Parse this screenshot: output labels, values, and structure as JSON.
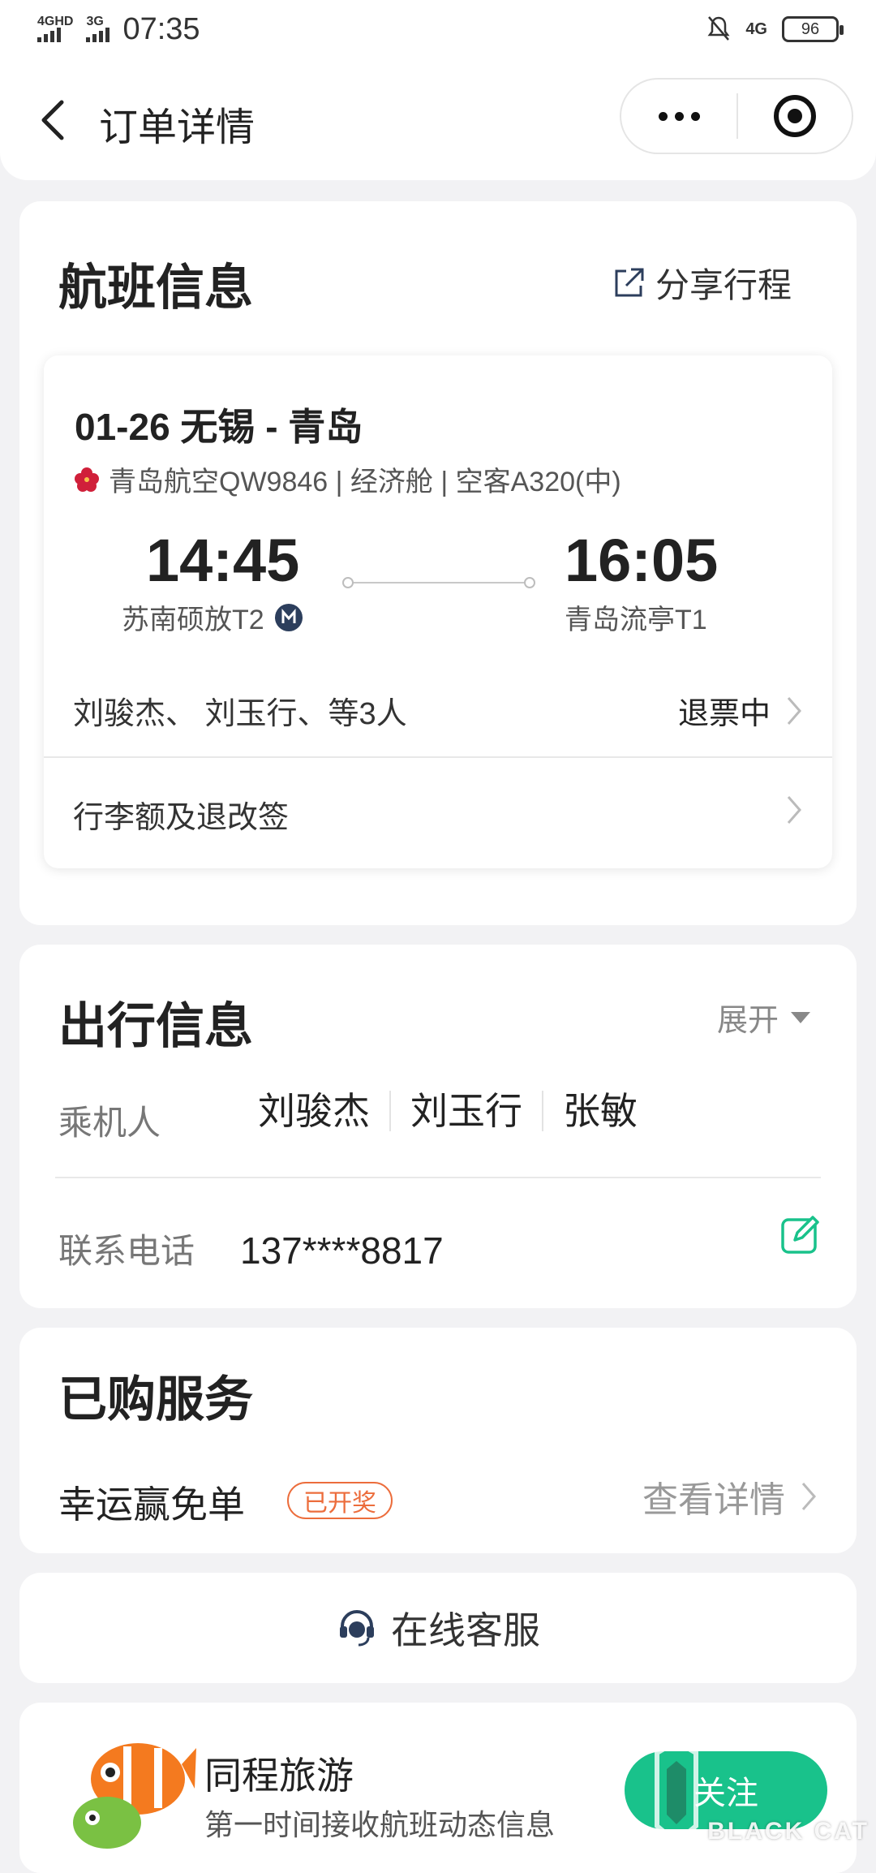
{
  "status_bar": {
    "net1": "4GHD",
    "net2": "3G",
    "time": "07:35",
    "net3": "4G",
    "battery": "96"
  },
  "nav": {
    "title": "订单详情"
  },
  "flight_card": {
    "title": "航班信息",
    "share_label": "分享行程",
    "route": "01-26 无锡 - 青岛",
    "airline_info": "青岛航空QW9846 | 经济舱 | 空客A320(中)",
    "dep_time": "14:45",
    "dep_airport": "苏南硕放T2",
    "arr_time": "16:05",
    "arr_airport": "青岛流亭T1",
    "passengers_summary": "刘骏杰、 刘玉行、等3人",
    "status": "退票中",
    "baggage": "行李额及退改签"
  },
  "travel_card": {
    "title": "出行信息",
    "expand_label": "展开",
    "passenger_label": "乘机人",
    "passengers": [
      "刘骏杰",
      "刘玉行",
      "张敏"
    ],
    "phone_label": "联系电话",
    "phone": "137****8817"
  },
  "services_card": {
    "title": "已购服务",
    "service_name": "幸运赢免单",
    "badge": "已开奖",
    "detail_label": "查看详情"
  },
  "support": {
    "label": "在线客服"
  },
  "promo": {
    "name": "同程旅游",
    "subtitle": "第一时间接收航班动态信息",
    "follow_label": "关注"
  },
  "watermark": {
    "text": "BLACK CAT"
  },
  "colors": {
    "accent_green": "#19c28b",
    "badge_orange": "#ec6d3c",
    "dark_blue": "#2c3e5c"
  }
}
